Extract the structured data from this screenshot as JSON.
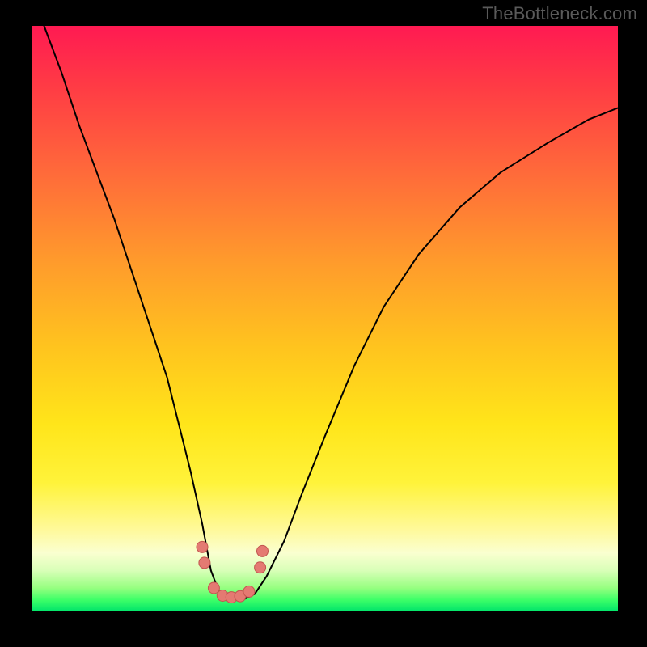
{
  "watermark": "TheBottleneck.com",
  "colors": {
    "frame": "#000000",
    "curve": "#000000",
    "marker_fill": "#e47a72",
    "marker_stroke": "#c2564f",
    "gradient_top": "#ff1a52",
    "gradient_bottom": "#00e46a"
  },
  "chart_data": {
    "type": "line",
    "title": "",
    "xlabel": "",
    "ylabel": "",
    "xlim": [
      0,
      100
    ],
    "ylim": [
      0,
      100
    ],
    "grid": false,
    "legend": false,
    "notes": "Bottleneck-style curve: a single V-shaped black curve on a vertical red→yellow→green gradient. No numeric axis ticks or labels are shown in the image; x/y values are estimated from pixel positions (0–100 normalized). Markers are small salmon dots clustered at the dip of the curve.",
    "series": [
      {
        "name": "curve",
        "x": [
          0,
          2,
          5,
          8,
          11,
          14,
          17,
          20,
          23,
          25,
          27,
          29,
          30.5,
          32,
          34,
          36,
          38,
          40,
          43,
          46,
          50,
          55,
          60,
          66,
          73,
          80,
          88,
          95,
          100
        ],
        "y": [
          105,
          100,
          92,
          83,
          75,
          67,
          58,
          49,
          40,
          32,
          24,
          15,
          7,
          3,
          2,
          2,
          3,
          6,
          12,
          20,
          30,
          42,
          52,
          61,
          69,
          75,
          80,
          84,
          86
        ]
      }
    ],
    "markers": {
      "name": "dip-markers",
      "x": [
        29.0,
        29.4,
        31.0,
        32.5,
        34.0,
        35.5,
        37.0,
        38.9,
        39.3
      ],
      "y": [
        11.0,
        8.3,
        4.0,
        2.7,
        2.4,
        2.6,
        3.4,
        7.5,
        10.3
      ]
    }
  }
}
